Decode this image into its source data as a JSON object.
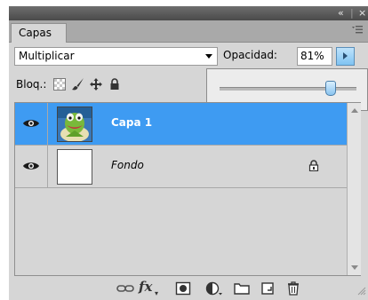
{
  "panel": {
    "tab_label": "Capas",
    "titlebar_controls": [
      "«",
      "|",
      "×"
    ]
  },
  "blend": {
    "mode": "Multiplicar"
  },
  "opacity": {
    "label": "Opacidad:",
    "value": "81%",
    "slider_fraction": 0.81
  },
  "lock": {
    "label": "Bloq.:"
  },
  "layers": [
    {
      "name": "Capa 1",
      "selected": true,
      "visible": true,
      "locked": false
    },
    {
      "name": "Fondo",
      "selected": false,
      "visible": true,
      "locked": true
    }
  ],
  "colors": {
    "selection": "#3e9bf2",
    "panel_bg": "#d6d6d6",
    "titlebar": "#555555"
  },
  "toolbar": {
    "icons": [
      "link-layers-icon",
      "layer-style-fx-icon",
      "layer-mask-icon",
      "adjustment-layer-icon",
      "group-folder-icon",
      "new-layer-icon",
      "delete-trash-icon"
    ],
    "fx_label": "fx"
  }
}
